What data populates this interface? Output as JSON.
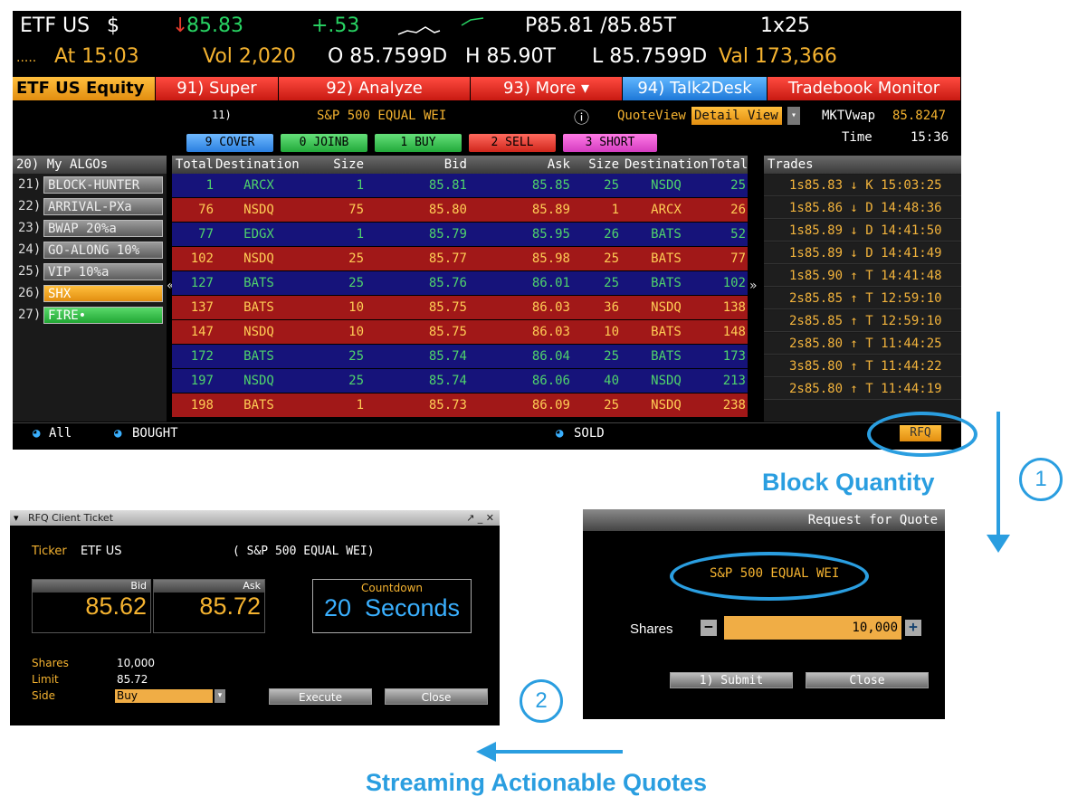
{
  "header": {
    "ticker": "ETF US",
    "currency": "$",
    "arrow": "↓",
    "last": "85.83",
    "change": "+.53",
    "bid_ask": "P85.81 /85.85T",
    "size": "1x25"
  },
  "row2": {
    "dots": ".....",
    "at": "At 15:03",
    "vol": "Vol 2,020",
    "open": "O 85.7599D",
    "high": "H 85.90T",
    "low": "L 85.7599D",
    "val": "Val 173,366"
  },
  "fkeys": {
    "equity": "ETF US Equity",
    "super": "91) Super",
    "analyze": "92) Analyze",
    "more": "93) More",
    "talk": "94) Talk2Desk",
    "tradebook": "Tradebook Monitor"
  },
  "info": {
    "num": "11)",
    "name": "S&P 500 EQUAL WEI",
    "info_icon": "ⓘ",
    "qv_label": "QuoteView",
    "qv_value": "Detail View",
    "mktvwap_label": "MKTVwap",
    "mktvwap_value": "85.8247",
    "time_label": "Time",
    "time_value": "15:36"
  },
  "actions": {
    "cover": "9 COVER",
    "joinb": "0 JOINB",
    "buy": "1 BUY",
    "sell": "2 SELL",
    "short": "3 SHORT"
  },
  "algos": {
    "header": "20) My ALGOs",
    "items": [
      {
        "num": "21)",
        "label": "BLOCK-HUNTER"
      },
      {
        "num": "22)",
        "label": "ARRIVAL-PXa"
      },
      {
        "num": "23)",
        "label": "BWAP 20%a"
      },
      {
        "num": "24)",
        "label": "GO-ALONG 10%"
      },
      {
        "num": "25)",
        "label": "VIP 10%a"
      },
      {
        "num": "26)",
        "label": "SHX"
      },
      {
        "num": "27)",
        "label": "FIRE•"
      }
    ]
  },
  "book": {
    "headers": {
      "total": "Total",
      "dest": "Destination",
      "size": "Size",
      "bid": "Bid",
      "ask": "Ask",
      "size2": "Size",
      "dest2": "Destination",
      "total2": "Total"
    },
    "rows": [
      {
        "t1": "1",
        "d1": "ARCX",
        "s1": "1",
        "bid": "85.81",
        "ask": "85.85",
        "s2": "25",
        "d2": "NSDQ",
        "t2": "25",
        "c": "blue"
      },
      {
        "t1": "76",
        "d1": "NSDQ",
        "s1": "75",
        "bid": "85.80",
        "ask": "85.89",
        "s2": "1",
        "d2": "ARCX",
        "t2": "26",
        "c": "red"
      },
      {
        "t1": "77",
        "d1": "EDGX",
        "s1": "1",
        "bid": "85.79",
        "ask": "85.95",
        "s2": "26",
        "d2": "BATS",
        "t2": "52",
        "c": "blue"
      },
      {
        "t1": "102",
        "d1": "NSDQ",
        "s1": "25",
        "bid": "85.77",
        "ask": "85.98",
        "s2": "25",
        "d2": "BATS",
        "t2": "77",
        "c": "red"
      },
      {
        "t1": "127",
        "d1": "BATS",
        "s1": "25",
        "bid": "85.76",
        "ask": "86.01",
        "s2": "25",
        "d2": "BATS",
        "t2": "102",
        "c": "blue"
      },
      {
        "t1": "137",
        "d1": "BATS",
        "s1": "10",
        "bid": "85.75",
        "ask": "86.03",
        "s2": "36",
        "d2": "NSDQ",
        "t2": "138",
        "c": "red"
      },
      {
        "t1": "147",
        "d1": "NSDQ",
        "s1": "10",
        "bid": "85.75",
        "ask": "86.03",
        "s2": "10",
        "d2": "BATS",
        "t2": "148",
        "c": "red"
      },
      {
        "t1": "172",
        "d1": "BATS",
        "s1": "25",
        "bid": "85.74",
        "ask": "86.04",
        "s2": "25",
        "d2": "BATS",
        "t2": "173",
        "c": "blue"
      },
      {
        "t1": "197",
        "d1": "NSDQ",
        "s1": "25",
        "bid": "85.74",
        "ask": "86.06",
        "s2": "40",
        "d2": "NSDQ",
        "t2": "213",
        "c": "blue"
      },
      {
        "t1": "198",
        "d1": "BATS",
        "s1": "1",
        "bid": "85.73",
        "ask": "86.09",
        "s2": "25",
        "d2": "NSDQ",
        "t2": "238",
        "c": "red"
      }
    ]
  },
  "trades": {
    "header": "Trades",
    "rows": [
      "1s85.83 ↓ K 15:03:25",
      "1s85.86 ↓ D 14:48:36",
      "1s85.89 ↓ D 14:41:50",
      "1s85.89 ↓ D 14:41:49",
      "1s85.90 ↑ T 14:41:48",
      "2s85.85 ↑ T 12:59:10",
      "2s85.85 ↑ T 12:59:10",
      "2s85.80 ↑ T 11:44:25",
      "3s85.80 ↑ T 11:44:22",
      "2s85.80 ↑ T 11:44:19"
    ]
  },
  "footer": {
    "all": "All",
    "bought": "BOUGHT",
    "sold": "SOLD",
    "rfq": "RFQ"
  },
  "annotations": {
    "block": "Block Quantity",
    "streaming": "Streaming Actionable Quotes",
    "step1": "1",
    "step2": "2"
  },
  "rfq": {
    "title": "Request for Quote",
    "name": "S&P 500 EQUAL WEI",
    "shares_label": "Shares",
    "shares_value": "10,000",
    "submit": "1) Submit",
    "close": "Close"
  },
  "ticket": {
    "title": "RFQ Client Ticket",
    "win_ctrls": "↗ _ ✕",
    "ticker_label": "Ticker",
    "ticker": "ETF US",
    "name": "( S&P 500 EQUAL WEI)",
    "bid_label": "Bid",
    "ask_label": "Ask",
    "bid": "85.62",
    "ask": "85.72",
    "countdown_label": "Countdown",
    "countdown": "20  Seconds",
    "shares_label": "Shares",
    "shares": "10,000",
    "limit_label": "Limit",
    "limit": "85.72",
    "side_label": "Side",
    "side": "Buy",
    "execute": "Execute",
    "close": "Close"
  },
  "colors": {
    "accent": "#2a9ee0",
    "amber": "#f5b330"
  }
}
